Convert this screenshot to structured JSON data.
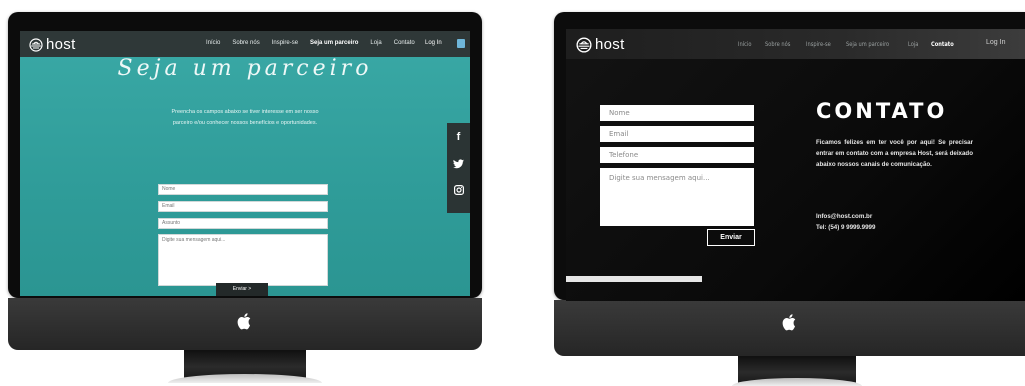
{
  "left_screen": {
    "logo_text": "host",
    "nav": [
      "Início",
      "Sobre nós",
      "Inspire-se",
      "Seja um parceiro",
      "Loja",
      "Contato"
    ],
    "active_nav": "Seja um parceiro",
    "login": "Log In",
    "title": "Seja um parceiro",
    "description": "Preencha os campos abaixo se tiver interesse em ser nosso parceiro e/ou conhecer nossos benefícios e oportunidades.",
    "fields": [
      "Nome",
      "Email",
      "Assunto"
    ],
    "message_placeholder": "Digite sua mensagem aqui...",
    "send_label": "Enviar  >",
    "social": [
      "facebook-icon",
      "twitter-icon",
      "instagram-icon"
    ]
  },
  "right_screen": {
    "logo_text": "host",
    "nav": [
      "Início",
      "Sobre nós",
      "Inspire-se",
      "Seja um parceiro",
      "Loja",
      "Contato"
    ],
    "active_nav": "Contato",
    "login": "Log In",
    "fields": [
      "Nome",
      "Email",
      "Telefone"
    ],
    "message_placeholder": "Digite sua mensagem aqui...",
    "send_label": "Enviar",
    "title": "CONTATO",
    "paragraph": "Ficamos felizes em ter você por aqui! Se precisar entrar em contato com a empresa Host, será deixado abaixo nossos canais de comunicação.",
    "email": "Infos@host.com.br",
    "phone": "Tel: (54) 9 9999.9999"
  },
  "colors": {
    "left_background": "#2f9c99",
    "nav_dark": "#2f3838",
    "right_background": "#0a0a0a"
  }
}
